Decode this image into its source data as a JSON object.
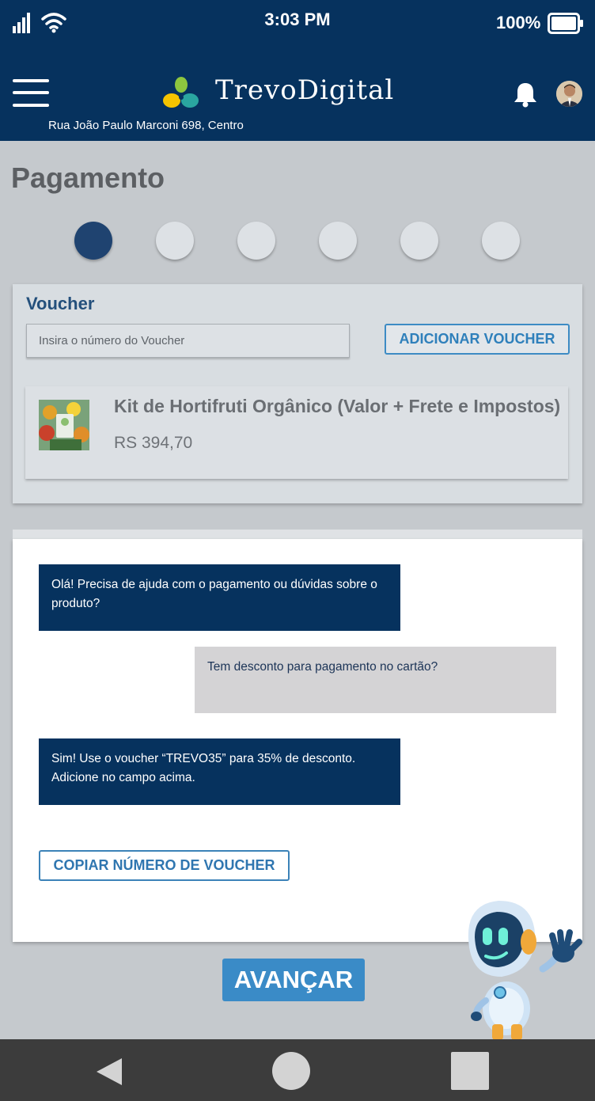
{
  "status_bar": {
    "time": "3:03 PM",
    "battery": "100%"
  },
  "header": {
    "brand": "TrevoDigital",
    "address": "Rua João Paulo Marconi 698, Centro"
  },
  "page": {
    "title": "Pagamento",
    "steps_total": 6,
    "current_step": 1
  },
  "voucher": {
    "title": "Voucher",
    "placeholder": "Insira o número do Voucher",
    "value": "",
    "add_button": "ADICIONAR VOUCHER"
  },
  "product": {
    "name": "Kit de Hortifruti Orgânico (Valor + Frete e Impostos)",
    "price": "RS 394,70"
  },
  "chat": {
    "messages": [
      {
        "from": "bot",
        "text": "Olá! Precisa de ajuda com o pagamento ou dúvidas sobre o produto?"
      },
      {
        "from": "user",
        "text": "Tem desconto para pagamento no cartão?"
      },
      {
        "from": "bot",
        "text": "Sim! Use o voucher “TREVO35” para 35% de desconto. Adicione no campo acima."
      }
    ],
    "copy_button": "COPIAR NÚMERO DE VOUCHER"
  },
  "actions": {
    "advance": "AVANÇAR"
  },
  "colors": {
    "header_bg": "#06325e",
    "accent": "#3a8bc7",
    "step_active": "#1f4370",
    "page_bg": "#c5c9cd"
  },
  "icons": [
    "signal-icon",
    "wifi-icon",
    "battery-icon",
    "menu-icon",
    "trevo-logo",
    "bell-icon",
    "avatar",
    "robot-mascot",
    "nav-back-icon",
    "nav-home-icon",
    "nav-recent-icon"
  ]
}
